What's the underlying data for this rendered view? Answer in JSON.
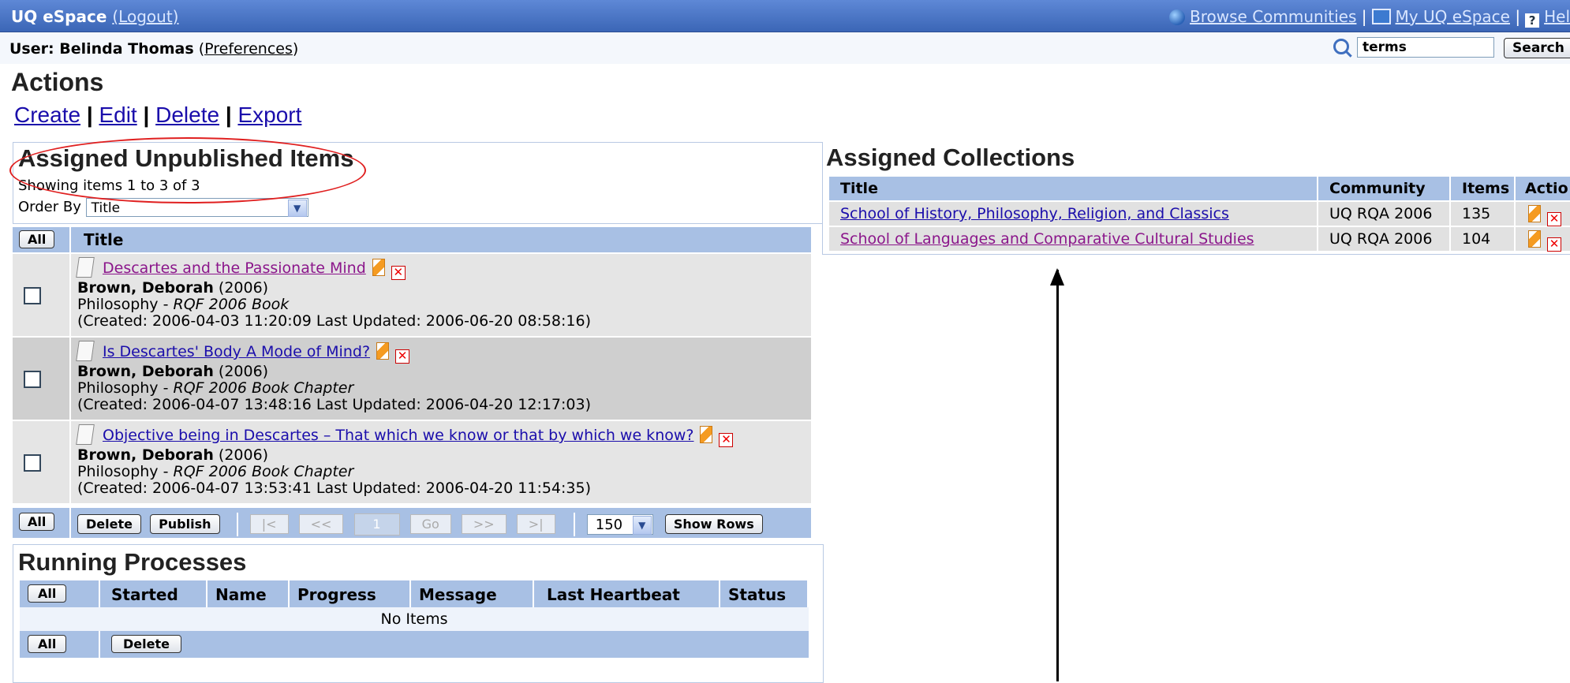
{
  "topbar": {
    "site": "UQ eSpace",
    "logout": "(Logout)",
    "browse": "Browse Communities",
    "my_espace": "My UQ eSpace",
    "help": "Hel",
    "sep": "|"
  },
  "userbar": {
    "user_prefix": "User: ",
    "user_name": "Belinda Thomas",
    "preferences": "Preferences",
    "search_value": "terms",
    "search_button": "Search"
  },
  "actions": {
    "heading": "Actions",
    "create": "Create",
    "edit": "Edit",
    "delete": "Delete",
    "export": "Export"
  },
  "unpublished": {
    "heading": "Assigned Unpublished Items",
    "showing": "Showing items 1 to 3 of 3",
    "order_by_label": "Order By",
    "order_by_value": "Title",
    "all_label": "All",
    "title_col": "Title",
    "items": [
      {
        "title": "Descartes and the Passionate Mind",
        "author": "Brown, Deborah",
        "year": "(2006)",
        "subject": "Philosophy - ",
        "type": "RQF 2006 Book",
        "dates": "(Created: 2006-04-03 11:20:09 Last Updated: 2006-06-20 08:58:16)"
      },
      {
        "title": "Is Descartes' Body A Mode of Mind?",
        "author": "Brown, Deborah",
        "year": "(2006)",
        "subject": "Philosophy - ",
        "type": "RQF 2006 Book Chapter",
        "dates": "(Created: 2006-04-07 13:48:16 Last Updated: 2006-04-20 12:17:03)"
      },
      {
        "title": "Objective being in Descartes – That which we know or that by which we know?",
        "author": "Brown, Deborah",
        "year": "(2006)",
        "subject": "Philosophy - ",
        "type": "RQF 2006 Book Chapter",
        "dates": "(Created: 2006-04-07 13:53:41 Last Updated: 2006-04-20 11:54:35)"
      }
    ],
    "pager": {
      "all": "All",
      "delete": "Delete",
      "publish": "Publish",
      "first": "|<",
      "prev": "<<",
      "page": "1",
      "go": "Go",
      "next": ">>",
      "last": ">|",
      "rows": "150",
      "show_rows": "Show Rows"
    }
  },
  "running": {
    "heading": "Running Processes",
    "all": "All",
    "cols": [
      "Started",
      "Name",
      "Progress",
      "Message",
      "Last Heartbeat",
      "Status"
    ],
    "no_items": "No Items",
    "delete": "Delete"
  },
  "collections": {
    "heading": "Assigned Collections",
    "cols": [
      "Title",
      "Community",
      "Items",
      "Actio"
    ],
    "rows": [
      {
        "title": "School of History, Philosophy, Religion, and Classics",
        "community": "UQ RQA 2006",
        "items": "135"
      },
      {
        "title": "School of Languages and Comparative Cultural Studies",
        "community": "UQ RQA 2006",
        "items": "104"
      }
    ]
  },
  "colors": {
    "topbar": "#4a76c6",
    "table_header": "#a8c0e4",
    "annotation": "#e02020"
  }
}
